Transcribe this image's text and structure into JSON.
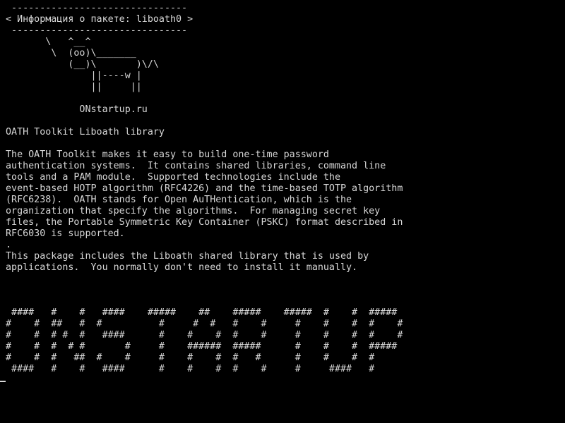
{
  "terminal": {
    "lines": [
      " -------------------------------",
      "< Информация о пакете: liboath0 >",
      " -------------------------------",
      "       \\   ^__^",
      "        \\  (oo)\\_______",
      "           (__)\\       )\\/\\",
      "               ||----w |",
      "               ||     ||",
      "",
      "             ONstartup.ru",
      "",
      "OATH Toolkit Liboath library",
      "",
      "The OATH Toolkit makes it easy to build one-time password",
      "authentication systems.  It contains shared libraries, command line",
      "tools and a PAM module.  Supported technologies include the",
      "event-based HOTP algorithm (RFC4226) and the time-based TOTP algorithm",
      "(RFC6238).  OATH stands for Open AuTHentication, which is the",
      "organization that specify the algorithms.  For managing secret key",
      "files, the Portable Symmetric Key Container (PSKC) format described in",
      "RFC6030 is supported.",
      ".",
      "This package includes the Liboath shared library that is used by",
      "applications.  You normally don't need to install it manually.",
      "",
      "",
      "",
      " ####   #    #   ####    #####    ##    #####    #####  #    #  #####",
      "#    #  ##   #  #          #     #  #   #    #     #    #    #  #    #",
      "#    #  # #  #   ####      #    #    #  #    #     #    #    #  #    #",
      "#    #  #  # #       #     #    ######  #####      #    #    #  #####",
      "#    #  #   ##  #    #     #    #    #  #   #      #    #    #  #",
      " ####   #    #   ####      #    #    #  #    #     #     ####   #"
    ]
  }
}
